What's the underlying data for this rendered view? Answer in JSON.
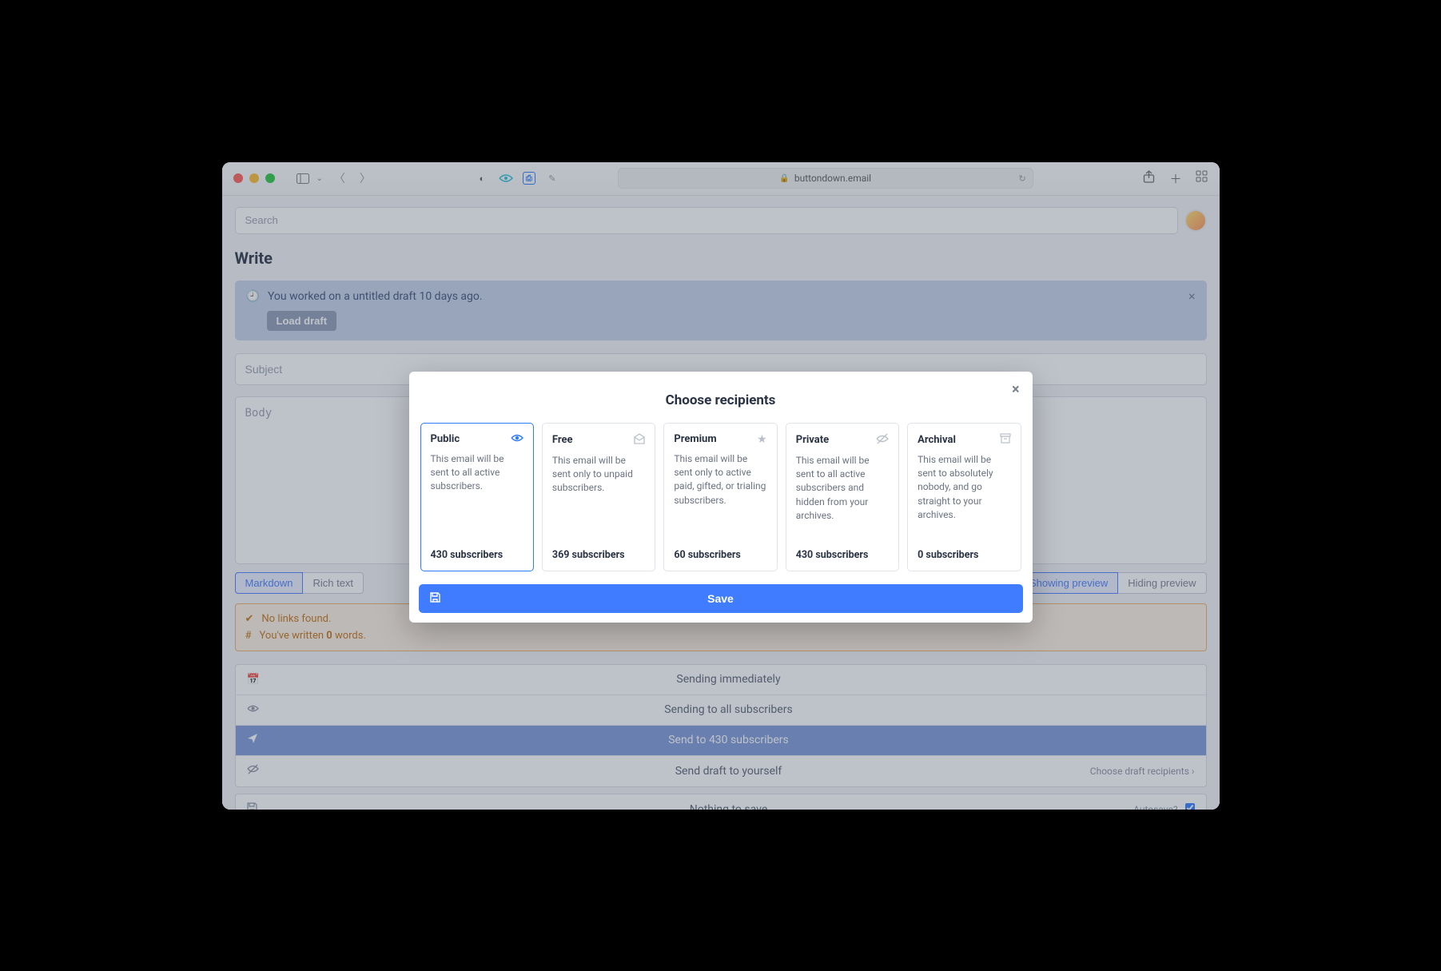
{
  "browser": {
    "url_label": "buttondown.email"
  },
  "search": {
    "placeholder": "Search"
  },
  "page": {
    "title": "Write"
  },
  "draft_banner": {
    "message": "You worked on a untitled draft 10 days ago.",
    "button": "Load draft"
  },
  "editor": {
    "subject_placeholder": "Subject",
    "body_placeholder": "Body",
    "format_tabs": {
      "markdown": "Markdown",
      "richtext": "Rich text"
    },
    "preview_tabs": {
      "showing": "Showing preview",
      "hiding": "Hiding preview"
    }
  },
  "info": {
    "no_links": "No links found.",
    "word_count_prefix": "You've written ",
    "word_count_value": "0",
    "word_count_suffix": " words."
  },
  "actions": {
    "sending_immediately": "Sending immediately",
    "sending_to_all": "Sending to all subscribers",
    "send_to_n": "Send to 430 subscribers",
    "send_draft": "Send draft to yourself",
    "choose_draft_recipients": "Choose draft recipients",
    "nothing_to_save": "Nothing to save",
    "autosave_label": "Autosave?"
  },
  "modal": {
    "title": "Choose recipients",
    "save_label": "Save",
    "cards": [
      {
        "name": "Public",
        "desc": "This email will be sent to all active subscribers.",
        "count": "430 subscribers",
        "icon": "eye"
      },
      {
        "name": "Free",
        "desc": "This email will be sent only to unpaid subscribers.",
        "count": "369 subscribers",
        "icon": "envelope"
      },
      {
        "name": "Premium",
        "desc": "This email will be sent only to active paid, gifted, or trialing subscribers.",
        "count": "60 subscribers",
        "icon": "star"
      },
      {
        "name": "Private",
        "desc": "This email will be sent to all active subscribers and hidden from your archives.",
        "count": "430 subscribers",
        "icon": "eye-off"
      },
      {
        "name": "Archival",
        "desc": "This email will be sent to absolutely nobody, and go straight to your archives.",
        "count": "0 subscribers",
        "icon": "archive"
      }
    ]
  }
}
